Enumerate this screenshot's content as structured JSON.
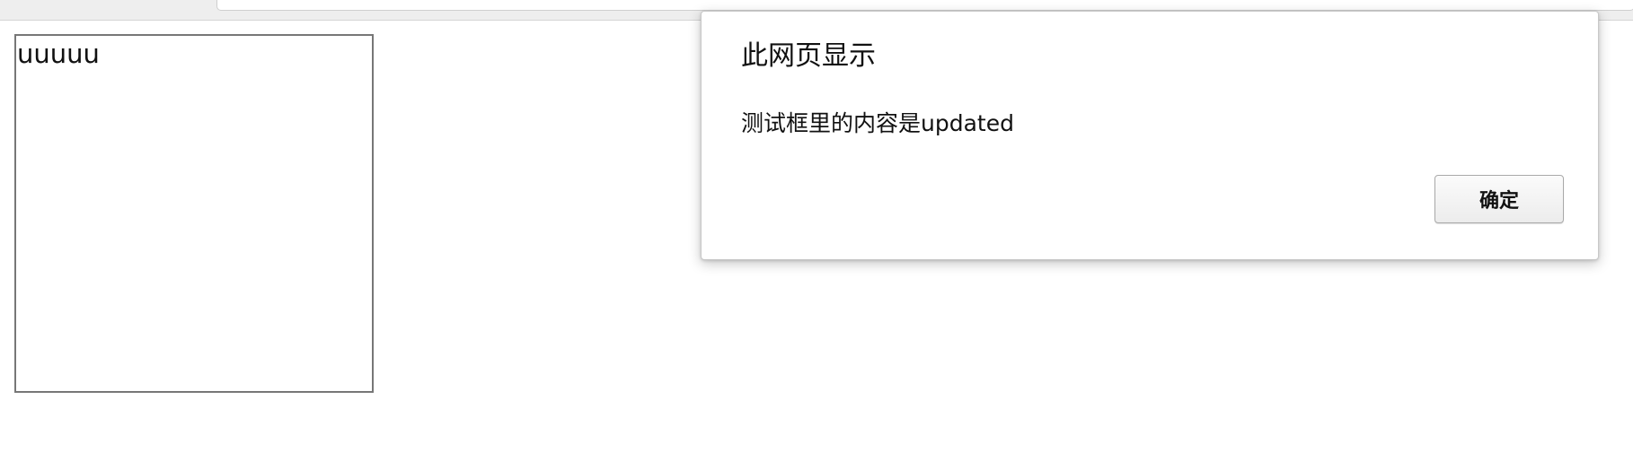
{
  "test_box": {
    "text": "uuuuu"
  },
  "alert_dialog": {
    "title": "此网页显示",
    "message": "测试框里的内容是updated",
    "ok_label": "确定"
  }
}
